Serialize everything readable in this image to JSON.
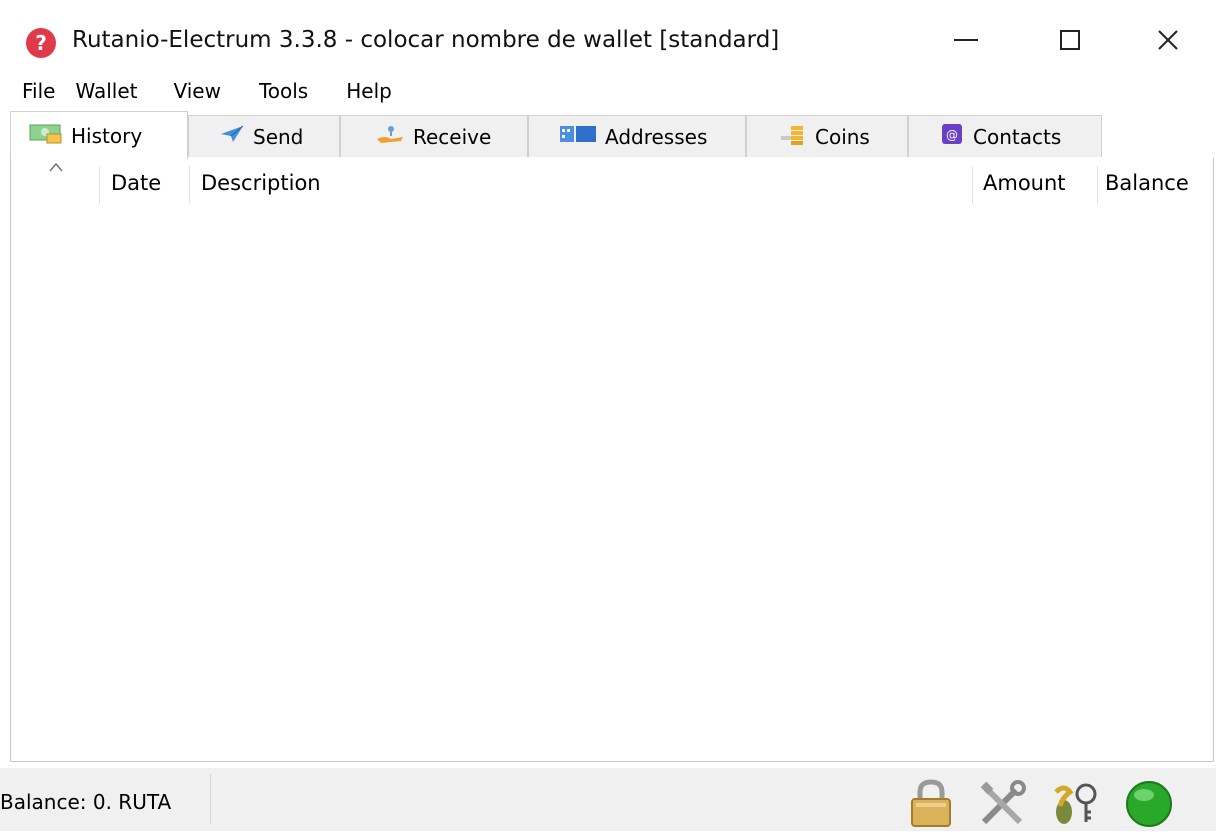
{
  "window": {
    "title": "Rutanio-Electrum 3.3.8  -  colocar nombre de wallet  [standard]",
    "app_icon_glyph": "?",
    "controls": [
      "minimize",
      "maximize",
      "close"
    ]
  },
  "menu": [
    {
      "label": "File"
    },
    {
      "label": "Wallet"
    },
    {
      "label": "View"
    },
    {
      "label": "Tools"
    },
    {
      "label": "Help"
    }
  ],
  "tabs": [
    {
      "label": "History",
      "icon": "history-icon",
      "active": true
    },
    {
      "label": "Send",
      "icon": "send-icon"
    },
    {
      "label": "Receive",
      "icon": "receive-icon"
    },
    {
      "label": "Addresses",
      "icon": "addresses-icon"
    },
    {
      "label": "Coins",
      "icon": "coins-icon"
    },
    {
      "label": "Contacts",
      "icon": "contacts-icon"
    }
  ],
  "history_table": {
    "columns": [
      "Date",
      "Description",
      "Amount",
      "Balance"
    ],
    "rows": []
  },
  "status": {
    "balance_text": "Balance: 0. RUTA",
    "icons": [
      "lock-icon",
      "preferences-icon",
      "seed-icon",
      "network-status-icon"
    ],
    "network_color": "#22aa22"
  },
  "colors": {
    "app_icon": "#e03a4a",
    "contacts_icon": "#6a3fc8"
  }
}
